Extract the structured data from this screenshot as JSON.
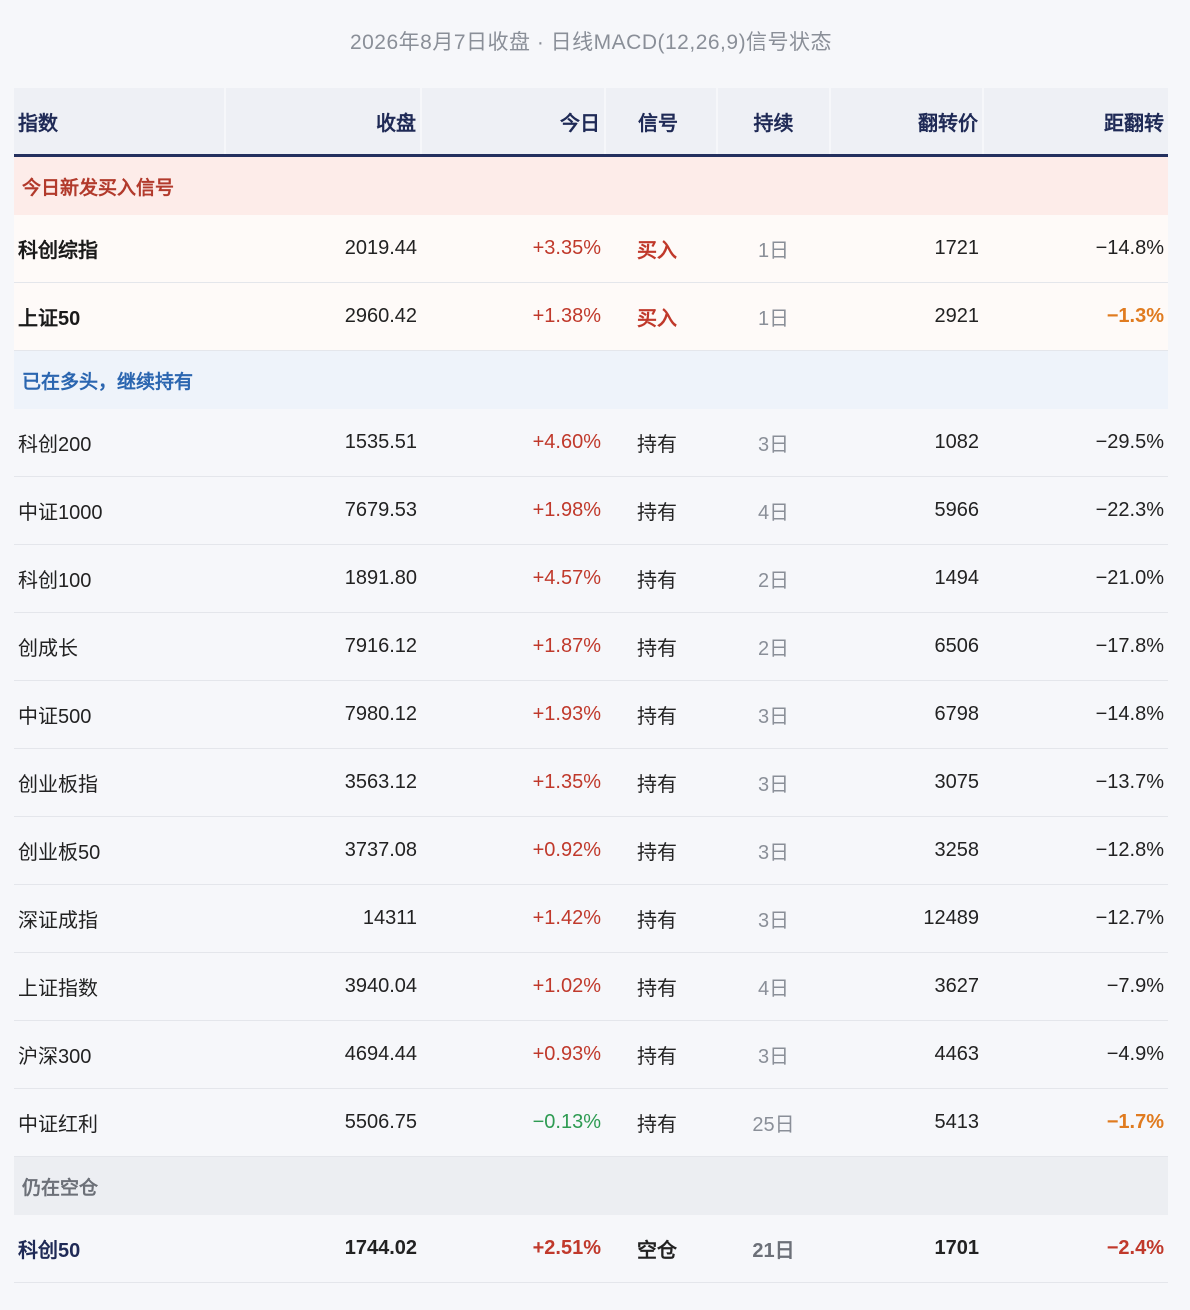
{
  "subtitle": "2026年8月7日收盘 · 日线MACD(12,26,9)信号状态",
  "table": {
    "headers": {
      "name": "指数",
      "close": "收盘",
      "change": "今日",
      "signal": "信号",
      "duration": "持续",
      "flip": "翻转价",
      "distance": "距翻转"
    },
    "groups": [
      {
        "label": "今日新发买入信号",
        "rows": [
          {
            "name": "科创综指",
            "close": "2019.44",
            "change": "+3.35%",
            "signal": "买入",
            "duration": "1日",
            "flip": "1721",
            "distance": "−14.8%"
          },
          {
            "name": "上证50",
            "close": "2960.42",
            "change": "+1.38%",
            "signal": "买入",
            "duration": "1日",
            "flip": "2921",
            "distance": "−1.3%"
          }
        ]
      },
      {
        "label": "已在多头，继续持有",
        "rows": [
          {
            "name": "科创200",
            "close": "1535.51",
            "change": "+4.60%",
            "signal": "持有",
            "duration": "3日",
            "flip": "1082",
            "distance": "−29.5%"
          },
          {
            "name": "中证1000",
            "close": "7679.53",
            "change": "+1.98%",
            "signal": "持有",
            "duration": "4日",
            "flip": "5966",
            "distance": "−22.3%"
          },
          {
            "name": "科创100",
            "close": "1891.80",
            "change": "+4.57%",
            "signal": "持有",
            "duration": "2日",
            "flip": "1494",
            "distance": "−21.0%"
          },
          {
            "name": "创成长",
            "close": "7916.12",
            "change": "+1.87%",
            "signal": "持有",
            "duration": "2日",
            "flip": "6506",
            "distance": "−17.8%"
          },
          {
            "name": "中证500",
            "close": "7980.12",
            "change": "+1.93%",
            "signal": "持有",
            "duration": "3日",
            "flip": "6798",
            "distance": "−14.8%"
          },
          {
            "name": "创业板指",
            "close": "3563.12",
            "change": "+1.35%",
            "signal": "持有",
            "duration": "3日",
            "flip": "3075",
            "distance": "−13.7%"
          },
          {
            "name": "创业板50",
            "close": "3737.08",
            "change": "+0.92%",
            "signal": "持有",
            "duration": "3日",
            "flip": "3258",
            "distance": "−12.8%"
          },
          {
            "name": "深证成指",
            "close": "14311",
            "change": "+1.42%",
            "signal": "持有",
            "duration": "3日",
            "flip": "12489",
            "distance": "−12.7%"
          },
          {
            "name": "上证指数",
            "close": "3940.04",
            "change": "+1.02%",
            "signal": "持有",
            "duration": "4日",
            "flip": "3627",
            "distance": "−7.9%"
          },
          {
            "name": "沪深300",
            "close": "4694.44",
            "change": "+0.93%",
            "signal": "持有",
            "duration": "3日",
            "flip": "4463",
            "distance": "−4.9%"
          },
          {
            "name": "中证红利",
            "close": "5506.75",
            "change": "−0.13%",
            "signal": "持有",
            "duration": "25日",
            "flip": "5413",
            "distance": "−1.7%"
          }
        ]
      },
      {
        "label": "仍在空仓",
        "rows": [
          {
            "name": "科创50",
            "close": "1744.02",
            "change": "+2.51%",
            "signal": "空仓",
            "duration": "21日",
            "flip": "1701",
            "distance": "−2.4%"
          }
        ]
      }
    ]
  },
  "colors": {
    "up": "#c0392b",
    "down": "#2e9b52",
    "warn": "#e07b1f",
    "header_text": "#1f2a56"
  }
}
